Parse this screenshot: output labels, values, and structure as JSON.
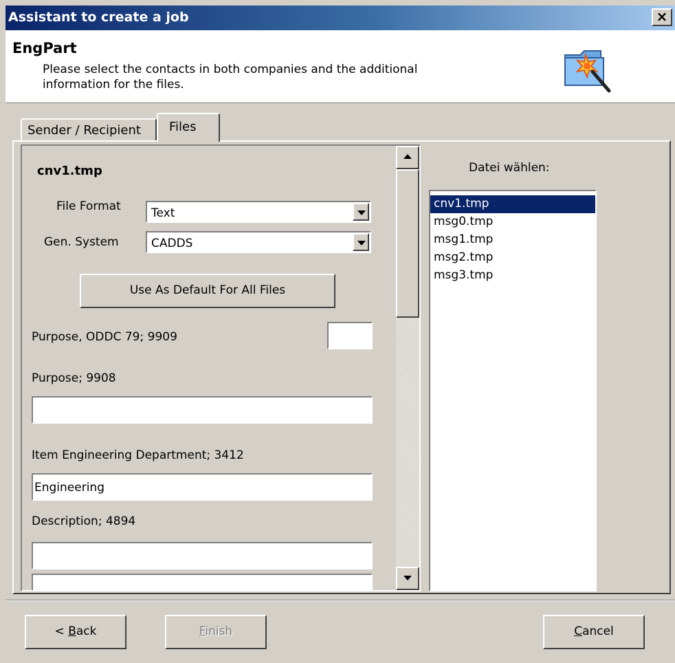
{
  "window": {
    "title": "Assistant to create a job",
    "close_label": "×"
  },
  "header": {
    "title": "EngPart",
    "subtitle": "Please select the contacts in both companies and the additional information for the files.",
    "icon": "wizard-folder-icon"
  },
  "tabs": [
    {
      "label": "Sender / Recipient",
      "active": false
    },
    {
      "label": "Files",
      "active": true
    }
  ],
  "file_panel": {
    "filename": "cnv1.tmp",
    "file_format": {
      "label": "File Format",
      "value": "Text"
    },
    "gen_system": {
      "label": "Gen. System",
      "value": "CADDS"
    },
    "default_button": "Use As Default For All Files",
    "purpose_oddc": {
      "label": "Purpose, ODDC 79; 9909",
      "value": ""
    },
    "purpose": {
      "label": "Purpose; 9908",
      "value": ""
    },
    "item_eng_dept": {
      "label": "Item Engineering Department; 3412",
      "value": "Engineering"
    },
    "description": {
      "label": "Description; 4894",
      "value": "",
      "value2": ""
    }
  },
  "file_list": {
    "label": "Datei wählen:",
    "items": [
      "cnv1.tmp",
      "msg0.tmp",
      "msg1.tmp",
      "msg2.tmp",
      "msg3.tmp"
    ],
    "selected": "cnv1.tmp"
  },
  "buttons": {
    "back": {
      "pre": "< ",
      "mnemonic": "B",
      "rest": "ack"
    },
    "finish": {
      "mnemonic": "F",
      "rest": "inish",
      "enabled": false
    },
    "cancel": {
      "mnemonic": "C",
      "rest": "ancel"
    }
  },
  "colors": {
    "title_bar_start": "#0a246a",
    "title_bar_end": "#a6caf0",
    "selection": "#0a246a",
    "face": "#d4d0c8"
  }
}
